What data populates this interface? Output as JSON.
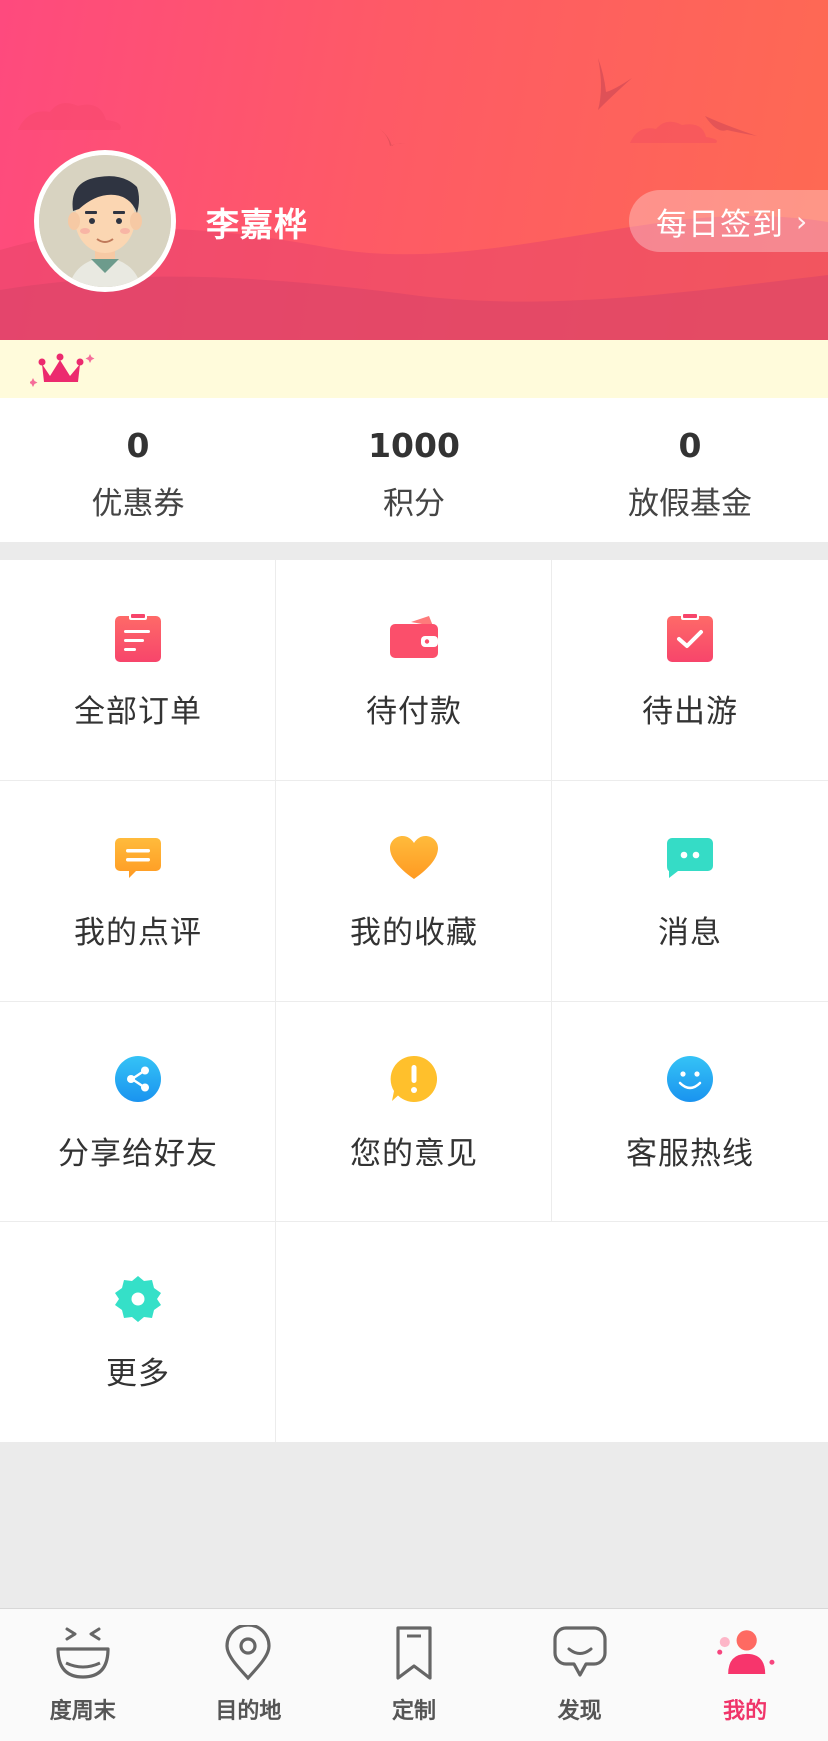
{
  "profile": {
    "name": "李嘉桦",
    "checkin_label": "每日签到",
    "checkin_chevron": "›"
  },
  "stats": [
    {
      "value": "0",
      "label": "优惠券"
    },
    {
      "value": "1000",
      "label": "积分"
    },
    {
      "value": "0",
      "label": "放假基金"
    }
  ],
  "menu": [
    {
      "label": "全部订单",
      "icon": "order-list-icon"
    },
    {
      "label": "待付款",
      "icon": "wallet-icon"
    },
    {
      "label": "待出游",
      "icon": "clipboard-check-icon"
    },
    {
      "label": "我的点评",
      "icon": "comment-icon"
    },
    {
      "label": "我的收藏",
      "icon": "heart-icon"
    },
    {
      "label": "消息",
      "icon": "message-icon"
    },
    {
      "label": "分享给好友",
      "icon": "share-icon"
    },
    {
      "label": "您的意见",
      "icon": "feedback-icon"
    },
    {
      "label": "客服热线",
      "icon": "smile-icon"
    },
    {
      "label": "更多",
      "icon": "gear-icon"
    }
  ],
  "tabs": [
    {
      "label": "度周末",
      "icon": "laugh-face-icon",
      "active": false
    },
    {
      "label": "目的地",
      "icon": "location-pin-icon",
      "active": false
    },
    {
      "label": "定制",
      "icon": "bookmark-icon",
      "active": false
    },
    {
      "label": "发现",
      "icon": "chat-bubble-icon",
      "active": false
    },
    {
      "label": "我的",
      "icon": "user-icon",
      "active": true
    }
  ],
  "colors": {
    "header_start": "#fe4a7e",
    "header_end": "#fe6a52",
    "accent": "#f0356a",
    "vip_bg": "#fffbdb"
  }
}
